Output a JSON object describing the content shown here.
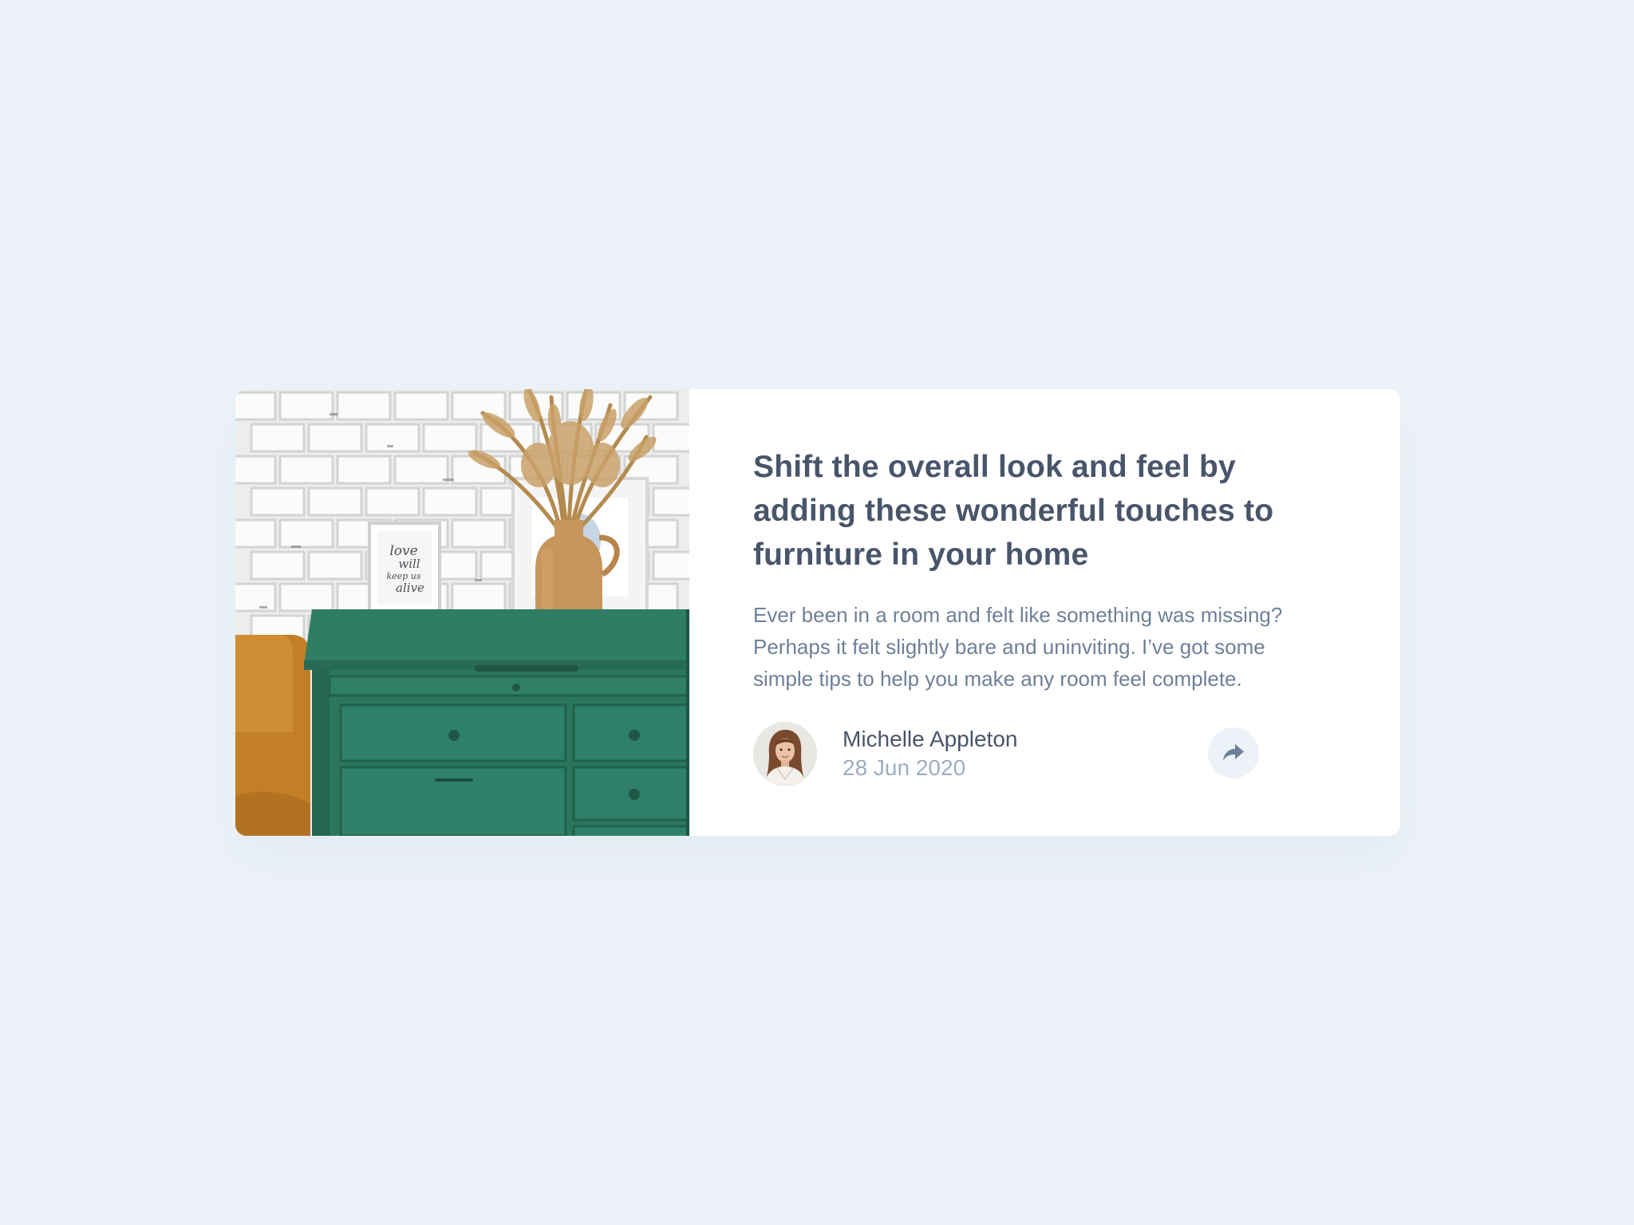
{
  "article": {
    "title": "Shift the overall look and feel by adding these wonderful touches to furniture in your home",
    "excerpt": "Ever been in a room and felt like something was missing? Perhaps it felt slightly bare and uninviting. I’ve got some simple tips to help you make any room feel complete.",
    "image_icon": "drawers-photo"
  },
  "frame_print": {
    "line1": "love",
    "line2": "will",
    "line3": "keep us",
    "line4": "alive"
  },
  "author": {
    "name": "Michelle Appleton",
    "date": "28 Jun 2020",
    "avatar_icon": "avatar-michelle"
  },
  "share": {
    "icon": "share-icon"
  },
  "colors": {
    "background": "#ECF2F8",
    "card": "#FFFFFF",
    "title": "#48556A",
    "body": "#6E8098",
    "muted": "#9DAEC2",
    "cabinet_green": "#2C7A62",
    "vase_tan": "#C8955C"
  }
}
